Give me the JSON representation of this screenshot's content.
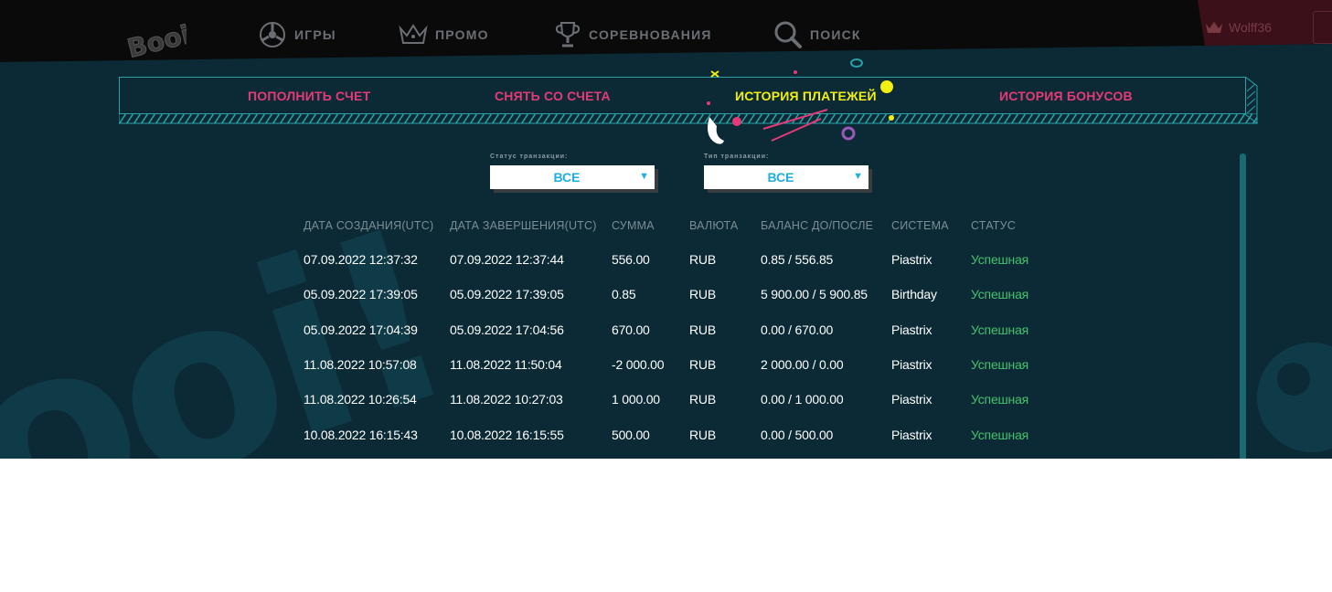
{
  "nav": {
    "logo_text": "Booi!",
    "items": [
      {
        "label": "ИГРЫ",
        "icon": "slots-reel-icon"
      },
      {
        "label": "ПРОМО",
        "icon": "crown-icon"
      },
      {
        "label": "СОРЕВНОВАНИЯ",
        "icon": "trophy-icon"
      },
      {
        "label": "ПОИСК",
        "icon": "search-icon"
      }
    ],
    "username": "Wolff36"
  },
  "tabs": [
    {
      "label": "ПОПОЛНИТЬ СЧЕТ",
      "active": false
    },
    {
      "label": "СНЯТЬ СО СЧЕТА",
      "active": false
    },
    {
      "label": "ИСТОРИЯ ПЛАТЕЖЕЙ",
      "active": true
    },
    {
      "label": "ИСТОРИЯ БОНУСОВ",
      "active": false
    }
  ],
  "filters": {
    "status": {
      "label": "Статус транзакции:",
      "value": "ВСЕ"
    },
    "type": {
      "label": "Тип транзакции:",
      "value": "ВСЕ"
    }
  },
  "table": {
    "headers": [
      "ДАТА СОЗДАНИЯ(UTC)",
      "ДАТА ЗАВЕРШЕНИЯ(UTC)",
      "СУММА",
      "ВАЛЮТА",
      "БАЛАНС ДО/ПОСЛЕ",
      "СИСТЕМА",
      "СТАТУС"
    ],
    "rows": [
      [
        "07.09.2022 12:37:32",
        "07.09.2022 12:37:44",
        "556.00",
        "RUB",
        "0.85 / 556.85",
        "Piastrix",
        "Успешная"
      ],
      [
        "05.09.2022 17:39:05",
        "05.09.2022 17:39:05",
        "0.85",
        "RUB",
        "5 900.00 / 5 900.85",
        "Birthday",
        "Успешная"
      ],
      [
        "05.09.2022 17:04:39",
        "05.09.2022 17:04:56",
        "670.00",
        "RUB",
        "0.00 / 670.00",
        "Piastrix",
        "Успешная"
      ],
      [
        "11.08.2022 10:57:08",
        "11.08.2022 11:50:04",
        "-2 000.00",
        "RUB",
        "2 000.00 / 0.00",
        "Piastrix",
        "Успешная"
      ],
      [
        "11.08.2022 10:26:54",
        "11.08.2022 10:27:03",
        "1 000.00",
        "RUB",
        "0.00 / 1 000.00",
        "Piastrix",
        "Успешная"
      ],
      [
        "10.08.2022 16:15:43",
        "10.08.2022 16:15:55",
        "500.00",
        "RUB",
        "0.00 / 500.00",
        "Piastrix",
        "Успешная"
      ]
    ]
  },
  "colors": {
    "background": "#0b2a36",
    "tab_inactive": "#e63a78",
    "tab_active": "#f2ef12",
    "status_success": "#45c26c",
    "select_text": "#1eaee0",
    "teal_border": "#2aa1a8"
  }
}
